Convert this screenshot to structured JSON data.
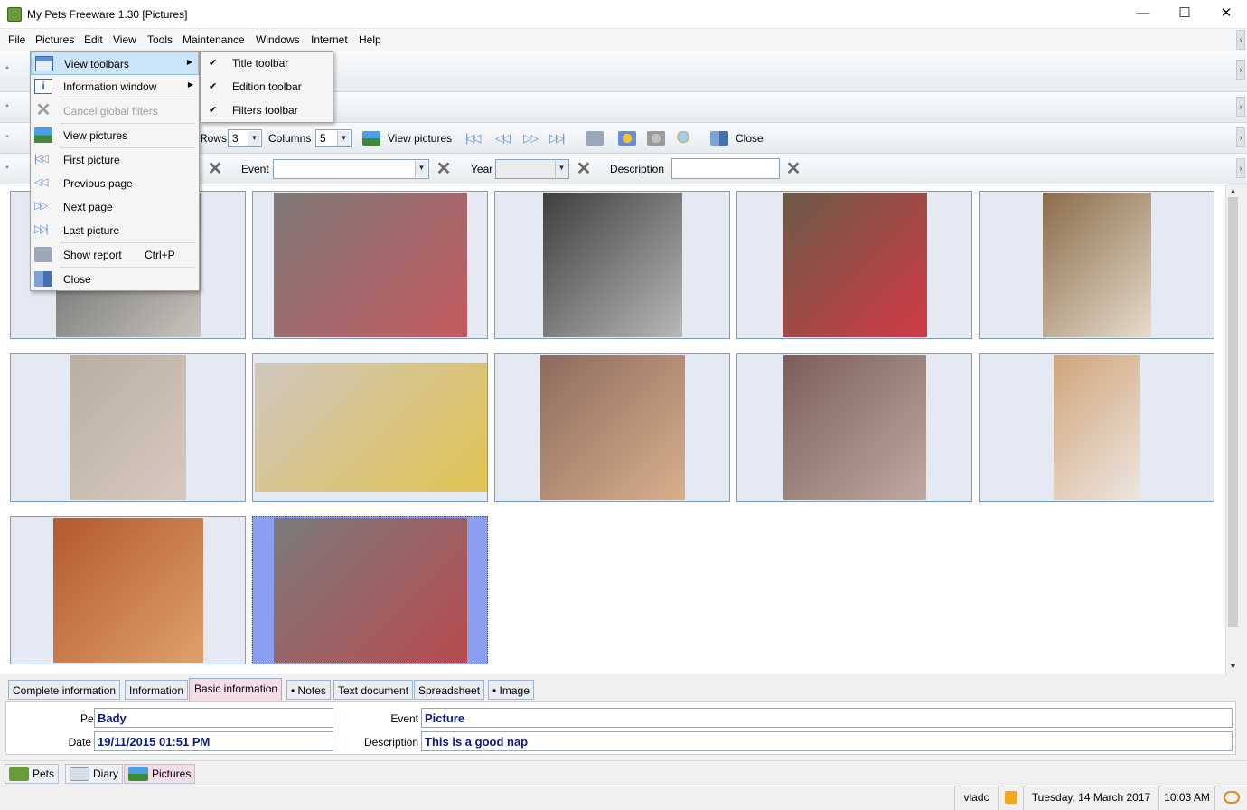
{
  "window": {
    "title": "My Pets Freeware 1.30 [Pictures]",
    "minimize": "—",
    "maximize": "☐",
    "close": "✕"
  },
  "menu": [
    "File",
    "Pictures",
    "Edit",
    "View",
    "Tools",
    "Maintenance",
    "Windows",
    "Internet",
    "Help"
  ],
  "pictures_toolbar": {
    "rows_label": "Rows",
    "rows_value": "3",
    "columns_label": "Columns",
    "columns_value": "5",
    "view_pictures": "View pictures",
    "close": "Close"
  },
  "filters_toolbar": {
    "event_label": "Event",
    "event_value": "",
    "year_label": "Year",
    "year_value": "",
    "description_label": "Description",
    "description_value": ""
  },
  "dropdown": {
    "items": [
      {
        "label": "View toolbars",
        "shortcut": "",
        "submenu": true,
        "disabled": false,
        "icon": "toolbars-icon"
      },
      {
        "label": "Information window",
        "shortcut": "",
        "submenu": true,
        "disabled": false,
        "icon": "info-icon"
      },
      {
        "label": "Cancel global filters",
        "shortcut": "",
        "submenu": false,
        "disabled": true,
        "icon": "cancel-filter-icon"
      },
      {
        "label": "View pictures",
        "shortcut": "",
        "submenu": false,
        "disabled": false,
        "icon": "landscape-icon"
      },
      {
        "label": "First picture",
        "shortcut": "",
        "submenu": false,
        "disabled": false,
        "icon": "first-icon"
      },
      {
        "label": "Previous page",
        "shortcut": "",
        "submenu": false,
        "disabled": false,
        "icon": "previous-icon"
      },
      {
        "label": "Next page",
        "shortcut": "",
        "submenu": false,
        "disabled": false,
        "icon": "next-icon"
      },
      {
        "label": "Last picture",
        "shortcut": "",
        "submenu": false,
        "disabled": false,
        "icon": "last-icon"
      },
      {
        "label": "Show report",
        "shortcut": "Ctrl+P",
        "submenu": false,
        "disabled": false,
        "icon": "printer-icon"
      },
      {
        "label": "Close",
        "shortcut": "",
        "submenu": false,
        "disabled": false,
        "icon": "close-window-icon"
      }
    ]
  },
  "submenu": {
    "items": [
      {
        "label": "Title toolbar",
        "checked": true
      },
      {
        "label": "Edition toolbar",
        "checked": true
      },
      {
        "label": "Filters toolbar",
        "checked": true
      }
    ]
  },
  "photos": [
    {
      "colors": [
        "#5b5e60",
        "#c9c4bd"
      ]
    },
    {
      "colors": [
        "#7d7a78",
        "#c45a5f"
      ]
    },
    {
      "colors": [
        "#3e3e3e",
        "#b8b8b8"
      ]
    },
    {
      "colors": [
        "#6a5a48",
        "#d23a45"
      ]
    },
    {
      "colors": [
        "#8a6c4a",
        "#e6dccc"
      ]
    },
    {
      "colors": [
        "#b9aea0",
        "#d8c9c0"
      ]
    },
    {
      "colors": [
        "#cfc6be",
        "#e1c350"
      ]
    },
    {
      "colors": [
        "#8d6a5e",
        "#d9b08c"
      ]
    },
    {
      "colors": [
        "#7a5f58",
        "#c0a9a2"
      ]
    },
    {
      "colors": [
        "#d0a57a",
        "#ede6e0"
      ]
    },
    {
      "colors": [
        "#b25a2a",
        "#e0a06a"
      ]
    },
    {
      "colors": [
        "#7b7b7b",
        "#b84a4f"
      ]
    }
  ],
  "info_tabs": [
    "Complete information",
    "Information",
    "Basic information",
    "• Notes",
    "Text document",
    "Spreadsheet",
    "• Image"
  ],
  "info": {
    "pet_label": "Pet",
    "pet": "Bady",
    "date_label": "Date",
    "date": "19/11/2015 01:51 PM",
    "event_label": "Event",
    "event": "Picture",
    "description_label": "Description",
    "description": "This is a good nap"
  },
  "bottom_tabs": [
    "Pets",
    "Diary",
    "Pictures"
  ],
  "status": {
    "user": "vladc",
    "date": "Tuesday, 14 March 2017",
    "time": "10:03 AM"
  },
  "colors": {
    "accent": "#0a1a80",
    "selection": "#8c9ef0",
    "active_tab": "#f4dde8",
    "menu_highlight": "#cce4f7"
  }
}
